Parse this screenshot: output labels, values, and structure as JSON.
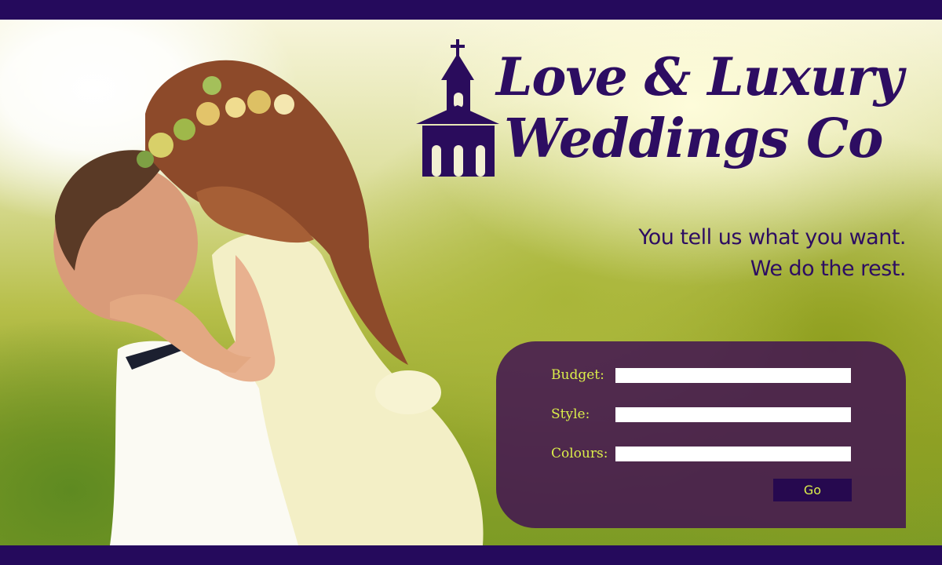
{
  "brand": {
    "line1": "Love & Luxury",
    "line2": "Weddings Co"
  },
  "tagline": {
    "line1": "You tell us what you want.",
    "line2": "We do the rest."
  },
  "form": {
    "budget_label": "Budget:",
    "budget_value": "",
    "style_label": "Style:",
    "style_value": "",
    "colours_label": "Colours:",
    "colours_value": "",
    "submit_label": "Go"
  },
  "colors": {
    "accent": "#250a5c",
    "label": "#dbee4a",
    "panel": "#421452"
  },
  "icons": [
    "church-logo-icon"
  ]
}
